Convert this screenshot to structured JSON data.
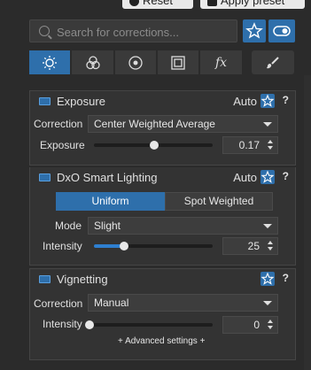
{
  "top": {
    "reset_label": "Reset",
    "apply_label": "Apply preset"
  },
  "search": {
    "placeholder": "Search for corrections..."
  },
  "tabs": [
    {
      "name": "light-icon",
      "active": true
    },
    {
      "name": "color-icon",
      "active": false
    },
    {
      "name": "detail-icon",
      "active": false
    },
    {
      "name": "geometry-icon",
      "active": false
    },
    {
      "name": "effects-icon",
      "label": "fx",
      "active": false
    },
    {
      "name": "local-adjust-icon",
      "active": false
    }
  ],
  "exposure": {
    "title": "Exposure",
    "auto_label": "Auto",
    "help": "?",
    "correction_label": "Correction",
    "correction_value": "Center Weighted Average",
    "exposure_label": "Exposure",
    "exposure_value": "0.17",
    "exposure_slider_fraction": 0.51
  },
  "smart_lighting": {
    "title": "DxO Smart Lighting",
    "auto_label": "Auto",
    "help": "?",
    "seg_uniform": "Uniform",
    "seg_spot": "Spot Weighted",
    "mode_label": "Mode",
    "mode_value": "Slight",
    "intensity_label": "Intensity",
    "intensity_value": "25",
    "intensity_fraction": 0.25
  },
  "vignetting": {
    "title": "Vignetting",
    "help": "?",
    "correction_label": "Correction",
    "correction_value": "Manual",
    "intensity_label": "Intensity",
    "intensity_value": "0",
    "intensity_fraction": 0.0,
    "advanced_label": "+ Advanced settings +"
  },
  "colors": {
    "accent": "#2e6fab",
    "background": "#2b2b2b"
  }
}
